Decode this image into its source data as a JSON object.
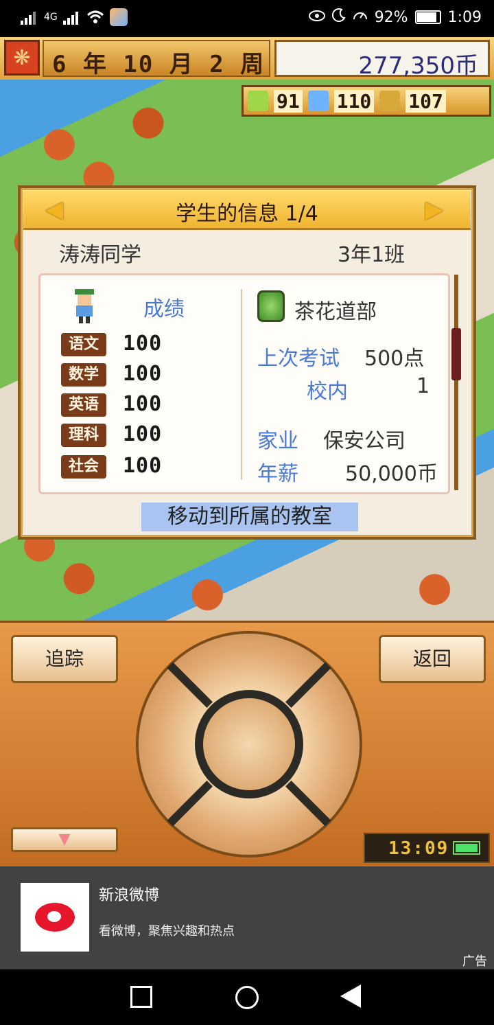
{
  "status_bar": {
    "network": "4G",
    "battery_percent": "92%",
    "time": "1:09",
    "icons": [
      "signal-icon",
      "wifi-icon",
      "eye-icon",
      "moon-icon",
      "speed-icon"
    ]
  },
  "top_bar": {
    "date": "6 年 10 月 2 周",
    "money": "277,350币"
  },
  "stats": {
    "items": [
      {
        "icon": "pencil-icon",
        "value": "91"
      },
      {
        "icon": "flask-icon",
        "value": "110"
      },
      {
        "icon": "trophy-icon",
        "value": "107"
      }
    ]
  },
  "panel": {
    "title": "学生的信息 1/4",
    "student_name": "涛涛同学",
    "student_class": "3年1班",
    "grades_label": "成绩",
    "subjects": [
      {
        "name": "语文",
        "score": "100"
      },
      {
        "name": "数学",
        "score": "100"
      },
      {
        "name": "英语",
        "score": "100"
      },
      {
        "name": "理科",
        "score": "100"
      },
      {
        "name": "社会",
        "score": "100"
      }
    ],
    "club": "茶花道部",
    "last_exam_label": "上次考试",
    "last_exam_value": "500点",
    "school_rank_label": "校内",
    "school_rank_value": "1",
    "family_business_label": "家业",
    "family_business_value": "保安公司",
    "salary_label": "年薪",
    "salary_value": "50,000币",
    "move_button": "移动到所属的教室"
  },
  "controls": {
    "track_label": "追踪",
    "back_label": "返回",
    "down_arrow": "▼",
    "clock": "13:09"
  },
  "ad": {
    "title": "新浪微博",
    "description": "看微博，聚焦兴趣和热点",
    "tag": "广告"
  },
  "colors": {
    "accent_blue": "#4a7ad6",
    "panel_header": "#f0b530",
    "wood": "#c26c22"
  }
}
